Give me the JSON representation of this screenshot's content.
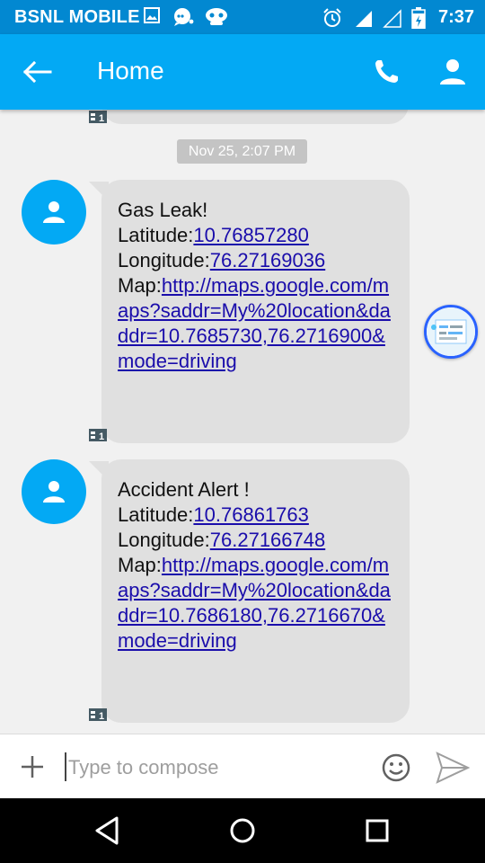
{
  "status_bar": {
    "carrier": "BSNL MOBILE",
    "time": "7:37",
    "icons": [
      "image-icon",
      "chat-bubble-icon",
      "game-controller-icon",
      "alarm-icon",
      "signal-icon",
      "signal-empty-icon",
      "battery-charging-icon"
    ]
  },
  "app_bar": {
    "title": "Home",
    "actions": [
      "back-arrow-icon",
      "phone-icon",
      "contact-icon"
    ]
  },
  "conversation": {
    "date_chip": "Nov 25, 2:07 PM",
    "messages": [
      {
        "sim": "1",
        "title": "Gas Leak!",
        "lat_label": "Latitude:",
        "lat_value": "10.76857280",
        "lon_label": "Longitude:",
        "lon_value": "76.27169036",
        "map_label": "Map:",
        "map_link": "http://maps.google.com/maps?saddr=My%20location&daddr=10.7685730,76.2716900&mode=driving"
      },
      {
        "sim": "1",
        "title": "Accident Alert !",
        "lat_label": "Latitude:",
        "lat_value": "10.76861763",
        "lon_label": "Longitude:",
        "lon_value": "76.27166748",
        "map_label": "Map:",
        "map_link": "http://maps.google.com/maps?saddr=My%20location&daddr=10.7686180,76.2716670&mode=driving"
      }
    ]
  },
  "compose": {
    "placeholder": "Type to compose"
  },
  "colors": {
    "status_bar": "#0288d1",
    "app_bar": "#03a9f4",
    "bubble": "#e0e0e0",
    "link": "#1a0dab"
  }
}
